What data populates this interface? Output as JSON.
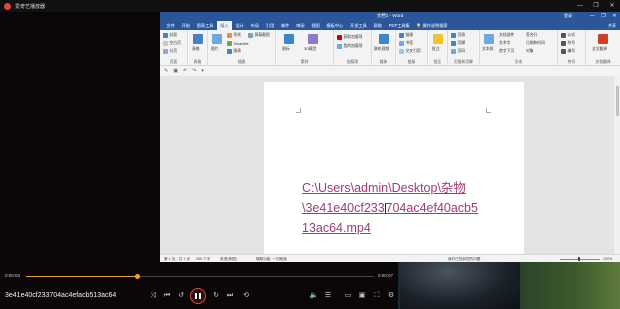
{
  "player": {
    "title": "爱奇艺播放器",
    "current_time": "0:00:03",
    "total_time": "0:00:07",
    "progress_fraction": 0.32,
    "file_name": "3e41e40cf233704ac4efacb513ac64",
    "accent_color": "#e0463c",
    "progress_color": "#e8a03a",
    "window_controls": [
      "—",
      "❐",
      "✕"
    ]
  },
  "word": {
    "doc_name": "文档1 - Word",
    "user": "登录",
    "window_controls": [
      "—",
      "❐",
      "✕"
    ],
    "tabs": [
      "文件",
      "开始",
      "图表工具",
      "插入",
      "设计",
      "布局",
      "引用",
      "邮件",
      "审阅",
      "视图",
      "模板中心",
      "开发工具",
      "帮助",
      "PDF工具集"
    ],
    "active_tab": "插入",
    "tell_me": "操作说明搜索",
    "share": "共享",
    "ribbon_groups": [
      {
        "label": "页面",
        "items": [
          "封面",
          "空白页",
          "分页"
        ]
      },
      {
        "label": "表格",
        "items": [
          "表格"
        ]
      },
      {
        "label": "插图",
        "items": [
          "图片",
          "形状",
          "SmartArt",
          "图表",
          "屏幕截图"
        ]
      },
      {
        "label": "素材",
        "items": [
          "图标",
          "3D模型"
        ]
      },
      {
        "label": "加载项",
        "items": [
          "获取加载项",
          "我的加载项"
        ]
      },
      {
        "label": "媒体",
        "items": [
          "联机视频"
        ]
      },
      {
        "label": "链接",
        "items": [
          "链接",
          "书签",
          "交叉引用"
        ]
      },
      {
        "label": "批注",
        "items": [
          "批注"
        ]
      },
      {
        "label": "页眉和页脚",
        "items": [
          "页眉",
          "页脚",
          "页码"
        ]
      },
      {
        "label": "文本",
        "items": [
          "文本框",
          "文档部件",
          "艺术字",
          "首字下沉",
          "签名行",
          "日期和时间",
          "对象"
        ]
      },
      {
        "label": "符号",
        "items": [
          "公式",
          "符号",
          "编号"
        ]
      },
      {
        "label": "文档翻译",
        "items": [
          "全文翻译"
        ]
      }
    ],
    "document_text_line1": "C:\\Users\\admin\\Desktop\\杂物",
    "document_text_line2a": "\\3e41e40cf233",
    "document_text_line2b": "704ac4ef40acb5",
    "document_text_line3": "13ac64.mp4",
    "hyperlink_color": "#9e3a78",
    "status": {
      "page": "第 1 页，共 1 页",
      "words": "355 个字",
      "language": "英语(美国)",
      "accessibility": "辅助功能: 一切就绪",
      "notice": "我们已找到您的问题",
      "zoom": "100%"
    }
  }
}
